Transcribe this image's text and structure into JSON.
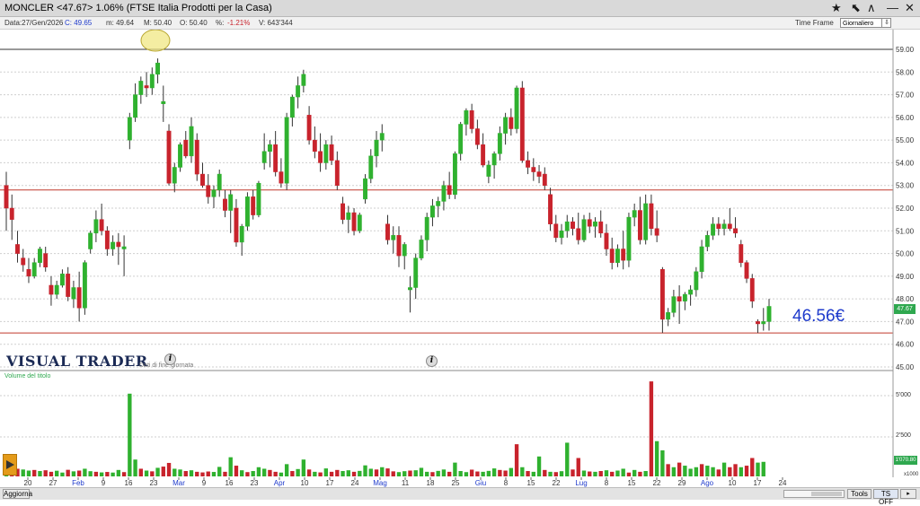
{
  "header": {
    "title": "MONCLER <47.67> 1.06%  (FTSE Italia Prodotti per la Casa)",
    "time_frame_label": "Time Frame",
    "time_frame_value": "Giornaliero"
  },
  "infobar": {
    "data": "Data:27/Gen/2026",
    "close": "C: 49.65",
    "low": "m: 49.64",
    "high": "M: 50.40",
    "open": "O: 50.40",
    "pct_label": "%:",
    "pct_value": "-1.21%",
    "volume": "V: 643'344"
  },
  "brand": {
    "name": "VISUAL TRADER",
    "sub": "Dati di fine giornata"
  },
  "annotation": {
    "price_text": "46.56€"
  },
  "price_tag": "47.67",
  "volume_tag": "1'070.80",
  "volume_panel": {
    "label": "Volume del titolo",
    "ticks": [
      "5'000",
      "2'500"
    ],
    "unit": "x1000"
  },
  "bottombar": {
    "refresh": "Aggiorna",
    "tools": "Tools",
    "ts": "TS OFF"
  },
  "colors": {
    "up": "#2fb12f",
    "down": "#c8232c",
    "accent": "#1f3bcc",
    "level_line": "#c0392b"
  },
  "chart_data": {
    "type": "candlestick",
    "y_axis_ticks": [
      "59.00",
      "58.00",
      "57.00",
      "56.00",
      "55.00",
      "54.00",
      "53.00",
      "52.00",
      "51.00",
      "50.00",
      "49.00",
      "48.00",
      "47.00",
      "46.00",
      "45.00"
    ],
    "ylim": [
      45,
      59.5
    ],
    "x_axis_labels": [
      {
        "label": "20",
        "month": false
      },
      {
        "label": "27",
        "month": false
      },
      {
        "label": "Feb",
        "month": true
      },
      {
        "label": "9",
        "month": false
      },
      {
        "label": "16",
        "month": false
      },
      {
        "label": "23",
        "month": false
      },
      {
        "label": "Mar",
        "month": true
      },
      {
        "label": "9",
        "month": false
      },
      {
        "label": "16",
        "month": false
      },
      {
        "label": "23",
        "month": false
      },
      {
        "label": "Apr",
        "month": true
      },
      {
        "label": "10",
        "month": false
      },
      {
        "label": "17",
        "month": false
      },
      {
        "label": "24",
        "month": false
      },
      {
        "label": "Mag",
        "month": true
      },
      {
        "label": "11",
        "month": false
      },
      {
        "label": "18",
        "month": false
      },
      {
        "label": "25",
        "month": false
      },
      {
        "label": "Giu",
        "month": true
      },
      {
        "label": "8",
        "month": false
      },
      {
        "label": "15",
        "month": false
      },
      {
        "label": "22",
        "month": false
      },
      {
        "label": "Lug",
        "month": true
      },
      {
        "label": "8",
        "month": false
      },
      {
        "label": "15",
        "month": false
      },
      {
        "label": "22",
        "month": false
      },
      {
        "label": "29",
        "month": false
      },
      {
        "label": "Ago",
        "month": true
      },
      {
        "label": "10",
        "month": false
      },
      {
        "label": "17",
        "month": false
      },
      {
        "label": "24",
        "month": false
      }
    ],
    "horizontal_levels": [
      59.0,
      52.8,
      46.5
    ],
    "candles": [
      [
        53.0,
        53.6,
        51.0,
        52.0
      ],
      [
        52.0,
        52.6,
        50.6,
        51.5
      ],
      [
        50.4,
        51.0,
        49.6,
        50.0
      ],
      [
        49.8,
        50.2,
        49.2,
        49.5
      ],
      [
        49.3,
        49.8,
        48.7,
        49.0
      ],
      [
        49.0,
        49.8,
        48.9,
        49.6
      ],
      [
        49.6,
        50.3,
        49.4,
        50.2
      ],
      [
        50.0,
        50.3,
        49.2,
        49.4
      ],
      [
        48.6,
        49.0,
        47.7,
        48.2
      ],
      [
        48.2,
        48.8,
        48.0,
        48.6
      ],
      [
        48.6,
        49.3,
        48.5,
        49.1
      ],
      [
        49.1,
        49.4,
        47.9,
        48.1
      ],
      [
        48.0,
        48.8,
        47.6,
        48.5
      ],
      [
        48.5,
        49.2,
        47.0,
        47.6
      ],
      [
        47.6,
        49.7,
        47.3,
        49.6
      ],
      [
        50.2,
        51.0,
        50.0,
        50.9
      ],
      [
        50.9,
        51.9,
        50.5,
        51.5
      ],
      [
        51.5,
        52.2,
        50.8,
        51.0
      ],
      [
        51.0,
        51.2,
        49.9,
        50.2
      ],
      [
        50.2,
        50.8,
        49.9,
        50.5
      ],
      [
        50.5,
        50.9,
        49.5,
        50.3
      ],
      [
        50.2,
        50.8,
        49.0,
        50.3
      ],
      [
        55.0,
        56.2,
        54.6,
        56.0
      ],
      [
        56.0,
        57.5,
        55.8,
        57.0
      ],
      [
        57.0,
        57.8,
        56.6,
        57.6
      ],
      [
        57.4,
        58.0,
        56.9,
        57.3
      ],
      [
        57.3,
        58.2,
        57.0,
        57.9
      ],
      [
        57.9,
        58.6,
        57.5,
        58.4
      ],
      [
        56.6,
        57.4,
        55.8,
        56.7
      ],
      [
        55.4,
        55.7,
        53.0,
        53.1
      ],
      [
        53.1,
        54.0,
        52.7,
        53.8
      ],
      [
        53.8,
        54.9,
        53.6,
        54.8
      ],
      [
        55.0,
        55.4,
        54.2,
        54.3
      ],
      [
        54.3,
        56.0,
        54.0,
        55.6
      ],
      [
        55.0,
        55.3,
        53.2,
        53.5
      ],
      [
        53.5,
        54.0,
        52.9,
        53.0
      ],
      [
        53.0,
        53.5,
        52.2,
        52.5
      ],
      [
        52.5,
        53.0,
        52.0,
        52.8
      ],
      [
        52.8,
        53.7,
        52.5,
        53.5
      ],
      [
        52.4,
        52.8,
        51.6,
        51.9
      ],
      [
        51.9,
        52.8,
        50.9,
        52.6
      ],
      [
        52.0,
        52.4,
        50.3,
        50.5
      ],
      [
        50.5,
        51.3,
        49.9,
        51.2
      ],
      [
        51.2,
        52.7,
        51.0,
        52.5
      ],
      [
        52.5,
        52.8,
        51.5,
        51.7
      ],
      [
        51.7,
        53.2,
        51.6,
        53.1
      ],
      [
        54.0,
        55.3,
        53.7,
        54.5
      ],
      [
        54.5,
        55.0,
        53.8,
        54.8
      ],
      [
        54.8,
        55.4,
        53.4,
        53.6
      ],
      [
        53.6,
        54.2,
        52.9,
        53.1
      ],
      [
        53.1,
        56.2,
        52.8,
        56.0
      ],
      [
        56.0,
        57.0,
        55.6,
        56.9
      ],
      [
        56.9,
        57.8,
        56.4,
        57.4
      ],
      [
        57.4,
        58.1,
        57.1,
        57.9
      ],
      [
        56.1,
        56.5,
        54.8,
        55.0
      ],
      [
        55.0,
        55.6,
        54.2,
        54.5
      ],
      [
        54.5,
        55.3,
        53.6,
        54.0
      ],
      [
        54.0,
        55.0,
        53.7,
        54.8
      ],
      [
        54.8,
        55.2,
        53.9,
        54.1
      ],
      [
        54.1,
        54.5,
        52.8,
        53.0
      ],
      [
        52.2,
        52.5,
        51.3,
        51.5
      ],
      [
        51.5,
        52.1,
        50.9,
        51.8
      ],
      [
        51.8,
        52.0,
        50.8,
        51.0
      ],
      [
        51.0,
        51.8,
        50.9,
        51.7
      ],
      [
        52.4,
        53.5,
        52.2,
        53.3
      ],
      [
        53.3,
        54.6,
        53.1,
        54.3
      ],
      [
        54.3,
        55.4,
        53.8,
        55.0
      ],
      [
        55.0,
        55.7,
        54.5,
        55.3
      ],
      [
        51.3,
        51.7,
        50.4,
        50.6
      ],
      [
        50.6,
        51.2,
        50.0,
        50.8
      ],
      [
        50.8,
        51.2,
        49.4,
        49.9
      ],
      [
        49.9,
        50.5,
        49.3,
        50.4
      ],
      [
        48.4,
        49.0,
        47.4,
        48.5
      ],
      [
        48.5,
        50.0,
        48.0,
        49.8
      ],
      [
        49.8,
        50.8,
        49.7,
        50.6
      ],
      [
        50.6,
        51.8,
        50.1,
        51.6
      ],
      [
        51.6,
        52.4,
        51.2,
        52.1
      ],
      [
        52.1,
        52.5,
        51.6,
        52.3
      ],
      [
        52.3,
        53.2,
        51.9,
        53.0
      ],
      [
        53.0,
        53.6,
        52.4,
        52.6
      ],
      [
        52.6,
        54.5,
        52.4,
        54.4
      ],
      [
        54.4,
        55.8,
        54.1,
        55.7
      ],
      [
        55.7,
        56.4,
        55.2,
        56.3
      ],
      [
        56.3,
        56.6,
        55.3,
        55.5
      ],
      [
        55.5,
        55.9,
        54.6,
        54.8
      ],
      [
        54.8,
        55.3,
        53.8,
        53.9
      ],
      [
        53.4,
        54.1,
        53.1,
        53.9
      ],
      [
        53.9,
        54.5,
        53.3,
        54.4
      ],
      [
        54.4,
        55.6,
        54.1,
        55.3
      ],
      [
        55.3,
        56.2,
        54.8,
        56.0
      ],
      [
        56.0,
        56.4,
        55.2,
        55.5
      ],
      [
        55.5,
        57.4,
        55.3,
        57.3
      ],
      [
        57.3,
        57.6,
        54.0,
        54.1
      ],
      [
        54.1,
        54.5,
        53.5,
        53.8
      ],
      [
        53.8,
        54.2,
        53.2,
        53.6
      ],
      [
        53.6,
        53.9,
        53.1,
        53.4
      ],
      [
        53.5,
        53.8,
        52.8,
        53.0
      ],
      [
        52.6,
        52.9,
        51.0,
        51.3
      ],
      [
        51.3,
        51.7,
        50.5,
        50.7
      ],
      [
        50.7,
        51.3,
        50.4,
        51.0
      ],
      [
        51.0,
        51.7,
        50.7,
        51.4
      ],
      [
        51.4,
        51.6,
        50.8,
        51.1
      ],
      [
        51.1,
        51.8,
        50.4,
        50.6
      ],
      [
        50.6,
        51.7,
        50.5,
        51.5
      ],
      [
        51.5,
        51.8,
        50.9,
        51.2
      ],
      [
        51.2,
        51.6,
        50.7,
        51.4
      ],
      [
        51.4,
        51.9,
        50.7,
        50.9
      ],
      [
        50.9,
        51.3,
        49.9,
        50.2
      ],
      [
        50.2,
        50.7,
        49.3,
        49.6
      ],
      [
        49.6,
        50.4,
        49.4,
        50.2
      ],
      [
        50.2,
        51.0,
        49.3,
        49.7
      ],
      [
        49.7,
        51.8,
        49.4,
        51.6
      ],
      [
        51.6,
        52.2,
        51.2,
        51.9
      ],
      [
        51.9,
        52.5,
        50.4,
        50.6
      ],
      [
        50.6,
        52.6,
        50.4,
        52.2
      ],
      [
        52.2,
        52.6,
        50.8,
        51.1
      ],
      [
        51.1,
        51.9,
        50.5,
        50.8
      ],
      [
        49.3,
        49.4,
        46.5,
        47.1
      ],
      [
        47.1,
        47.6,
        46.8,
        47.4
      ],
      [
        47.4,
        48.4,
        47.2,
        48.1
      ],
      [
        48.1,
        48.6,
        46.9,
        47.9
      ],
      [
        47.9,
        48.3,
        47.5,
        48.2
      ],
      [
        48.2,
        48.6,
        47.7,
        48.4
      ],
      [
        48.4,
        49.4,
        48.1,
        49.2
      ],
      [
        49.2,
        50.6,
        48.9,
        50.3
      ],
      [
        50.3,
        51.0,
        50.1,
        50.8
      ],
      [
        50.8,
        51.6,
        50.6,
        51.3
      ],
      [
        51.3,
        51.6,
        50.8,
        51.1
      ],
      [
        51.1,
        51.5,
        50.8,
        51.3
      ],
      [
        51.3,
        52.0,
        51.0,
        51.1
      ],
      [
        51.1,
        51.6,
        50.7,
        50.9
      ],
      [
        50.4,
        50.6,
        49.4,
        49.6
      ],
      [
        49.6,
        49.7,
        48.7,
        48.9
      ],
      [
        48.9,
        49.1,
        47.6,
        47.9
      ],
      [
        47.0,
        47.1,
        46.5,
        46.9
      ],
      [
        46.9,
        47.6,
        46.6,
        47.0
      ],
      [
        47.0,
        48.0,
        46.6,
        47.67
      ]
    ],
    "volumes": [
      [
        1,
        900
      ],
      [
        0,
        700
      ],
      [
        0,
        500
      ],
      [
        1,
        450
      ],
      [
        1,
        380
      ],
      [
        0,
        420
      ],
      [
        1,
        350
      ],
      [
        0,
        400
      ],
      [
        0,
        300
      ],
      [
        1,
        370
      ],
      [
        1,
        250
      ],
      [
        0,
        430
      ],
      [
        1,
        330
      ],
      [
        0,
        380
      ],
      [
        1,
        500
      ],
      [
        1,
        340
      ],
      [
        0,
        300
      ],
      [
        1,
        260
      ],
      [
        0,
        290
      ],
      [
        1,
        250
      ],
      [
        1,
        420
      ],
      [
        0,
        280
      ],
      [
        1,
        5400
      ],
      [
        1,
        1100
      ],
      [
        0,
        500
      ],
      [
        1,
        380
      ],
      [
        0,
        330
      ],
      [
        1,
        560
      ],
      [
        0,
        640
      ],
      [
        0,
        880
      ],
      [
        1,
        500
      ],
      [
        1,
        450
      ],
      [
        0,
        350
      ],
      [
        1,
        400
      ],
      [
        0,
        300
      ],
      [
        0,
        260
      ],
      [
        0,
        320
      ],
      [
        1,
        290
      ],
      [
        1,
        620
      ],
      [
        0,
        300
      ],
      [
        1,
        1250
      ],
      [
        0,
        700
      ],
      [
        1,
        400
      ],
      [
        0,
        280
      ],
      [
        1,
        350
      ],
      [
        1,
        600
      ],
      [
        1,
        500
      ],
      [
        0,
        420
      ],
      [
        0,
        300
      ],
      [
        1,
        250
      ],
      [
        1,
        800
      ],
      [
        0,
        350
      ],
      [
        1,
        480
      ],
      [
        1,
        1100
      ],
      [
        0,
        450
      ],
      [
        1,
        300
      ],
      [
        0,
        260
      ],
      [
        1,
        520
      ],
      [
        0,
        300
      ],
      [
        0,
        420
      ],
      [
        1,
        350
      ],
      [
        1,
        400
      ],
      [
        0,
        300
      ],
      [
        1,
        360
      ],
      [
        1,
        720
      ],
      [
        1,
        500
      ],
      [
        0,
        450
      ],
      [
        1,
        600
      ],
      [
        0,
        520
      ],
      [
        0,
        330
      ],
      [
        1,
        280
      ],
      [
        1,
        340
      ],
      [
        0,
        380
      ],
      [
        1,
        400
      ],
      [
        1,
        560
      ],
      [
        1,
        300
      ],
      [
        0,
        280
      ],
      [
        1,
        360
      ],
      [
        1,
        450
      ],
      [
        0,
        300
      ],
      [
        1,
        900
      ],
      [
        1,
        350
      ],
      [
        1,
        280
      ],
      [
        0,
        440
      ],
      [
        0,
        320
      ],
      [
        1,
        300
      ],
      [
        1,
        360
      ],
      [
        1,
        520
      ],
      [
        0,
        420
      ],
      [
        0,
        380
      ],
      [
        1,
        550
      ],
      [
        0,
        2100
      ],
      [
        1,
        600
      ],
      [
        0,
        350
      ],
      [
        1,
        300
      ],
      [
        1,
        1300
      ],
      [
        0,
        420
      ],
      [
        1,
        300
      ],
      [
        0,
        280
      ],
      [
        1,
        340
      ],
      [
        1,
        2200
      ],
      [
        0,
        450
      ],
      [
        0,
        1200
      ],
      [
        1,
        380
      ],
      [
        0,
        320
      ],
      [
        1,
        300
      ],
      [
        0,
        350
      ],
      [
        1,
        400
      ],
      [
        0,
        300
      ],
      [
        1,
        380
      ],
      [
        1,
        500
      ],
      [
        0,
        250
      ],
      [
        1,
        420
      ],
      [
        0,
        300
      ],
      [
        1,
        350
      ],
      [
        0,
        6200
      ],
      [
        1,
        2300
      ],
      [
        1,
        1700
      ],
      [
        0,
        800
      ],
      [
        1,
        600
      ],
      [
        0,
        900
      ],
      [
        1,
        700
      ],
      [
        1,
        500
      ],
      [
        1,
        600
      ],
      [
        0,
        800
      ],
      [
        1,
        700
      ],
      [
        1,
        600
      ],
      [
        0,
        450
      ],
      [
        1,
        900
      ],
      [
        0,
        600
      ],
      [
        0,
        800
      ],
      [
        1,
        600
      ],
      [
        0,
        700
      ],
      [
        0,
        1200
      ],
      [
        1,
        900
      ],
      [
        1,
        950
      ]
    ],
    "volume_max": 6500
  }
}
